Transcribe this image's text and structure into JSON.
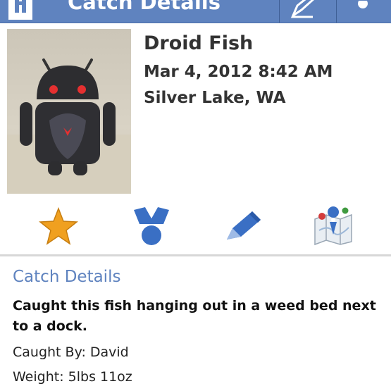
{
  "action_bar": {
    "title": "Catch Details",
    "home_icon": "home-icon",
    "edit_icon": "edit-icon",
    "overflow_icon": "overflow-menu-icon",
    "color": "#5f83bf"
  },
  "catch": {
    "photo": "android-figure-photo",
    "name": "Droid Fish",
    "datetime": "Mar 4, 2012 8:42 AM",
    "location": "Silver Lake, WA"
  },
  "actions": [
    {
      "icon": "star-icon",
      "color": "#f0a020"
    },
    {
      "icon": "badge-icon",
      "color": "#3a6fc4"
    },
    {
      "icon": "pencil-icon",
      "color": "#3a6fc4"
    },
    {
      "icon": "map-icon",
      "color": "#3a6fc4"
    }
  ],
  "details": {
    "heading": "Catch Details",
    "description": "Caught this fish hanging out in a weed bed next to a dock.",
    "caught_by": "Caught By: David",
    "weight": "Weight: 5lbs 11oz"
  }
}
